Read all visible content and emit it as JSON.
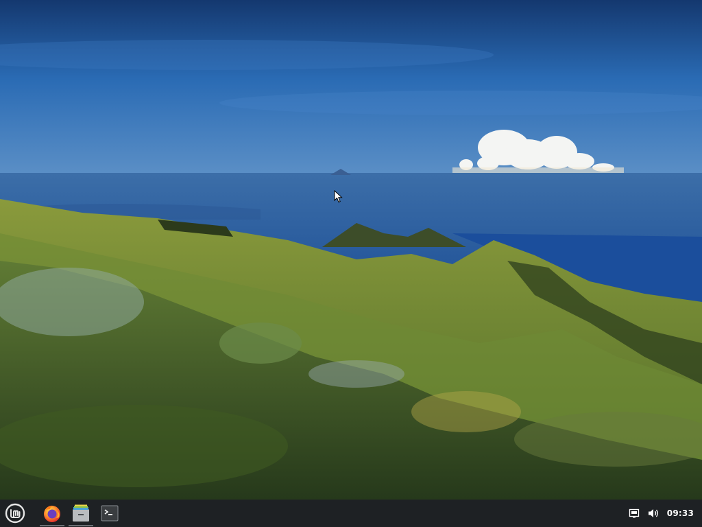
{
  "desktop": {
    "wallpaper": "mountain-landscape-wallpaper"
  },
  "taskbar": {
    "menu_icon": "mint-logo-icon",
    "launchers": [
      {
        "name": "firefox",
        "icon": "firefox-icon"
      },
      {
        "name": "files",
        "icon": "file-manager-icon"
      },
      {
        "name": "terminal",
        "icon": "terminal-icon"
      }
    ],
    "tray": {
      "network_icon": "network-wired-icon",
      "volume_icon": "volume-icon",
      "clock": "09:33"
    }
  },
  "colors": {
    "panel": "#1e2124",
    "accent": "#8fb84a",
    "sky": "#1f5aa6",
    "text": "#ffffff"
  }
}
